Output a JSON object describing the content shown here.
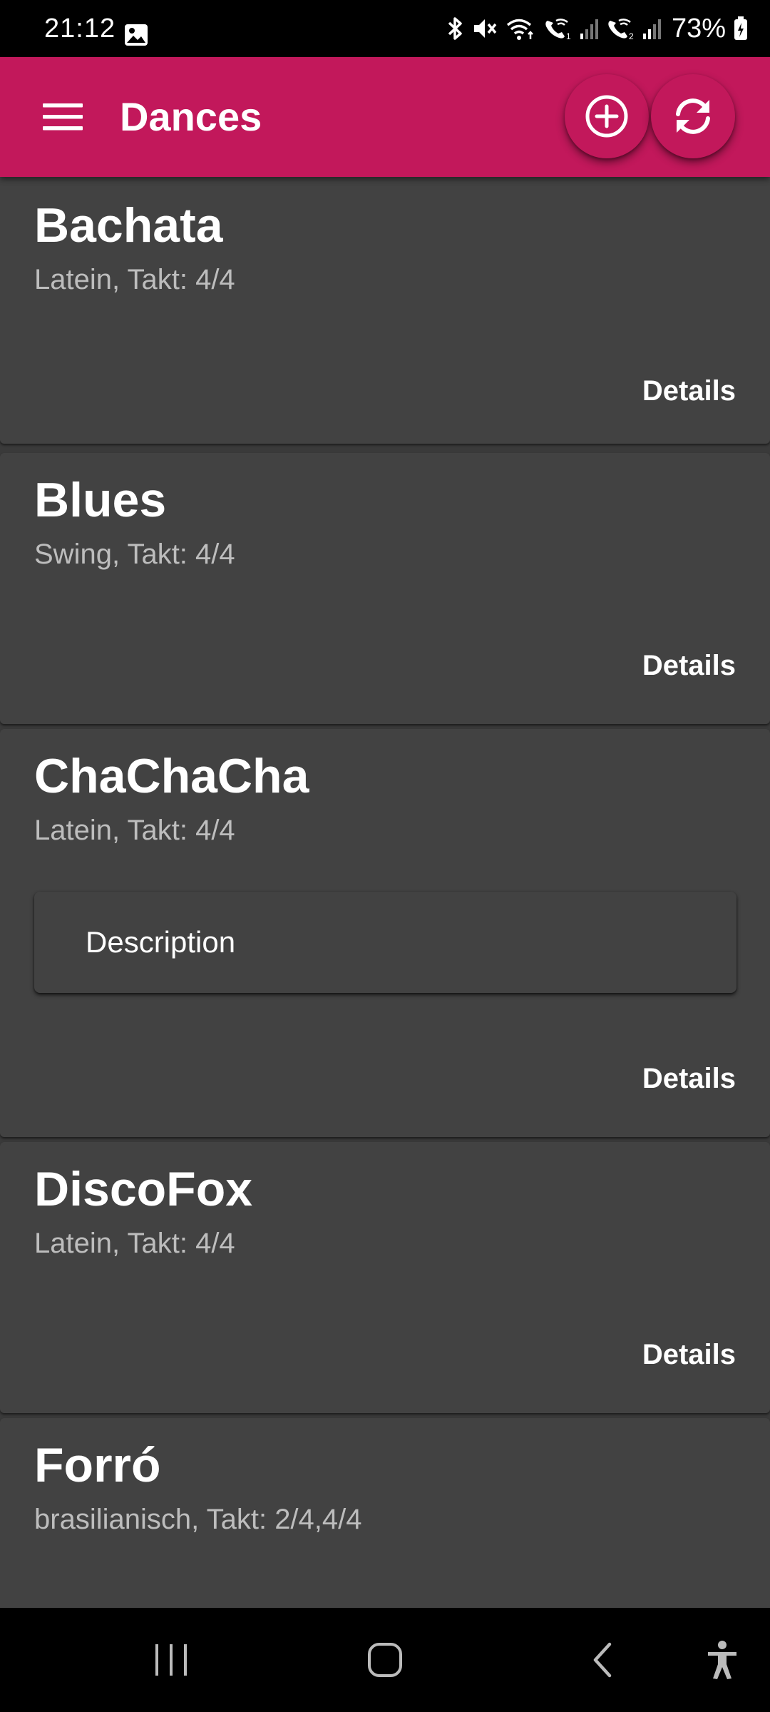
{
  "status_bar": {
    "time": "21:12",
    "battery": "73%",
    "icons": [
      "gallery-icon",
      "bluetooth-icon",
      "mute-icon",
      "wifi-icon",
      "wifi-calling-1-icon",
      "signal-1-icon",
      "wifi-calling-2-icon",
      "signal-2-icon",
      "battery-icon"
    ]
  },
  "app_bar": {
    "title": "Dances",
    "menu_icon": "menu-icon",
    "actions": [
      {
        "name": "add",
        "icon": "add-circle-icon"
      },
      {
        "name": "sync",
        "icon": "sync-icon"
      }
    ]
  },
  "dances": [
    {
      "name": "Bachata",
      "subtitle": "Latein, Takt: 4/4",
      "action": "Details"
    },
    {
      "name": "Blues",
      "subtitle": "Swing, Takt: 4/4",
      "action": "Details"
    },
    {
      "name": "ChaChaCha",
      "subtitle": "Latein, Takt: 4/4",
      "description": "Description",
      "action": "Details"
    },
    {
      "name": "DiscoFox",
      "subtitle": "Latein, Takt: 4/4",
      "action": "Details"
    },
    {
      "name": "Forró",
      "subtitle": "brasilianisch, Takt: 2/4,4/4"
    }
  ],
  "nav_bar": {
    "icons": [
      "recent-apps-icon",
      "home-icon",
      "back-icon",
      "accessibility-icon"
    ]
  },
  "colors": {
    "primary": "#c2185b",
    "card": "#424242",
    "list_background": "#3a3a3a",
    "subtitle": "#bdbdbd"
  }
}
